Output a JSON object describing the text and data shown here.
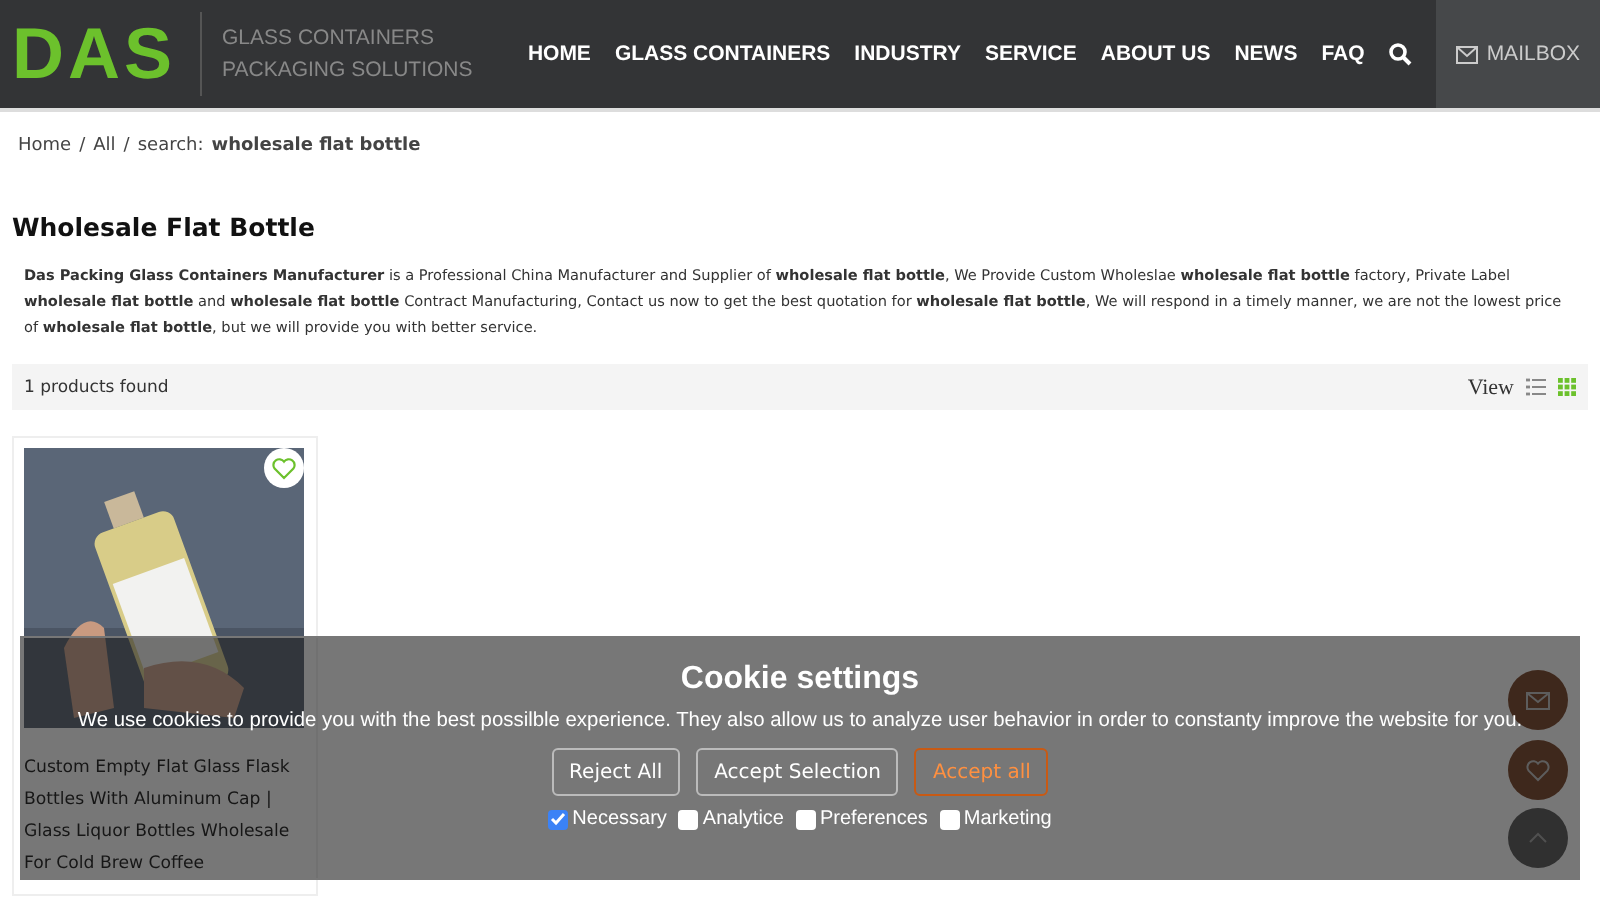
{
  "header": {
    "logo": "DAS",
    "tagline": "GLASS CONTAINERS PACKAGING SOLUTIONS",
    "nav": [
      {
        "label": "HOME"
      },
      {
        "label": "GLASS CONTAINERS"
      },
      {
        "label": "INDUSTRY"
      },
      {
        "label": "SERVICE"
      },
      {
        "label": "ABOUT US"
      },
      {
        "label": "NEWS"
      },
      {
        "label": "FAQ"
      }
    ],
    "mailbox": "MAILBOX"
  },
  "breadcrumb": {
    "items": [
      {
        "label": "Home",
        "separator": "/"
      },
      {
        "label": "All",
        "separator": "/"
      }
    ],
    "search_label": "search:",
    "query": "wholesale flat bottle"
  },
  "page_title": "Wholesale Flat Bottle",
  "description": "**Das Packing Glass Containers Manufacturer** is a Professional China Manufacturer and Supplier of **wholesale flat bottle**, We Provide Custom Wholeslae **wholesale flat bottle** factory, Private Label **wholesale flat bottle** and **wholesale flat bottle** Contract Manufacturing, Contact us now to get the best quotation for **wholesale flat bottle**, We will respond in a timely manner, we are not the lowest price of **wholesale flat bottle**, but we will provide you with better service.",
  "results_bar": {
    "count": "1 products found",
    "view_label": "View",
    "views": [
      {
        "kind": "list",
        "selected": false
      },
      {
        "kind": "grid",
        "selected": true
      }
    ]
  },
  "products": [
    {
      "kind": "picture",
      "title": "Custom Empty Flat Glass Flask Bottles With Aluminum Cap | Glass Liquor Bottles Wholesale For Cold Brew Coffee"
    }
  ],
  "cookie_banner": {
    "title": "Cookie settings",
    "text": "We use cookies to provide you with the best possilble experience. They also allow us to analyze user behavior in order to constanty improve the website for you.",
    "buttons": [
      {
        "label": "Reject All",
        "kind": "plain"
      },
      {
        "label": "Accept Selection",
        "kind": "plain"
      },
      {
        "label": "Accept all",
        "kind": "primary"
      }
    ],
    "options": [
      {
        "label": "Necessary",
        "checked": true
      },
      {
        "label": "Analytice",
        "checked": false
      },
      {
        "label": "Preferences",
        "checked": false
      },
      {
        "label": "Marketing",
        "checked": false
      }
    ]
  }
}
